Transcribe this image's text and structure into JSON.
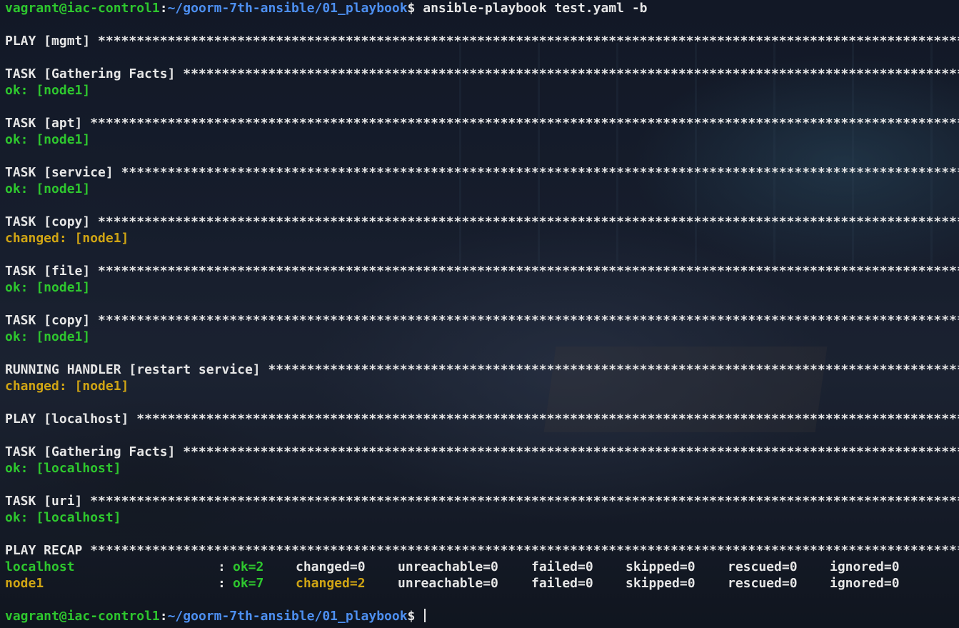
{
  "prompt": {
    "user_host": "vagrant@iac-control1",
    "sep": ":",
    "path": "~/goorm-7th-ansible/01_playbook",
    "dollar": "$ ",
    "command": "ansible-playbook test.yaml -b"
  },
  "stars": "************************************************************************************************************************************************************",
  "plays": [
    {
      "header": "PLAY [mgmt] ",
      "tasks": [
        {
          "header": "TASK [Gathering Facts] ",
          "result": "ok: [node1]",
          "status": "ok"
        },
        {
          "header": "TASK [apt] ",
          "result": "ok: [node1]",
          "status": "ok"
        },
        {
          "header": "TASK [service] ",
          "result": "ok: [node1]",
          "status": "ok"
        },
        {
          "header": "TASK [copy] ",
          "result": "changed: [node1]",
          "status": "changed"
        },
        {
          "header": "TASK [file] ",
          "result": "ok: [node1]",
          "status": "ok"
        },
        {
          "header": "TASK [copy] ",
          "result": "ok: [node1]",
          "status": "ok"
        },
        {
          "header": "RUNNING HANDLER [restart service] ",
          "result": "changed: [node1]",
          "status": "changed"
        }
      ]
    },
    {
      "header": "PLAY [localhost] ",
      "tasks": [
        {
          "header": "TASK [Gathering Facts] ",
          "result": "ok: [localhost]",
          "status": "ok"
        },
        {
          "header": "TASK [uri] ",
          "result": "ok: [localhost]",
          "status": "ok"
        }
      ]
    }
  ],
  "recap": {
    "header": "PLAY RECAP ",
    "rows": [
      {
        "host": "localhost",
        "host_status": "ok",
        "colon": ":",
        "ok": "ok=2",
        "changed": "changed=0",
        "changed_status": "none",
        "unreachable": "unreachable=0",
        "failed": "failed=0",
        "skipped": "skipped=0",
        "rescued": "rescued=0",
        "ignored": "ignored=0"
      },
      {
        "host": "node1",
        "host_status": "changed",
        "colon": ":",
        "ok": "ok=7",
        "changed": "changed=2",
        "changed_status": "changed",
        "unreachable": "unreachable=0",
        "failed": "failed=0",
        "skipped": "skipped=0",
        "rescued": "rescued=0",
        "ignored": "ignored=0"
      }
    ]
  },
  "colors": {
    "ok": "#2ec72e",
    "changed": "#d0a514",
    "path": "#4d8ff0",
    "text": "#e6e6e6"
  }
}
